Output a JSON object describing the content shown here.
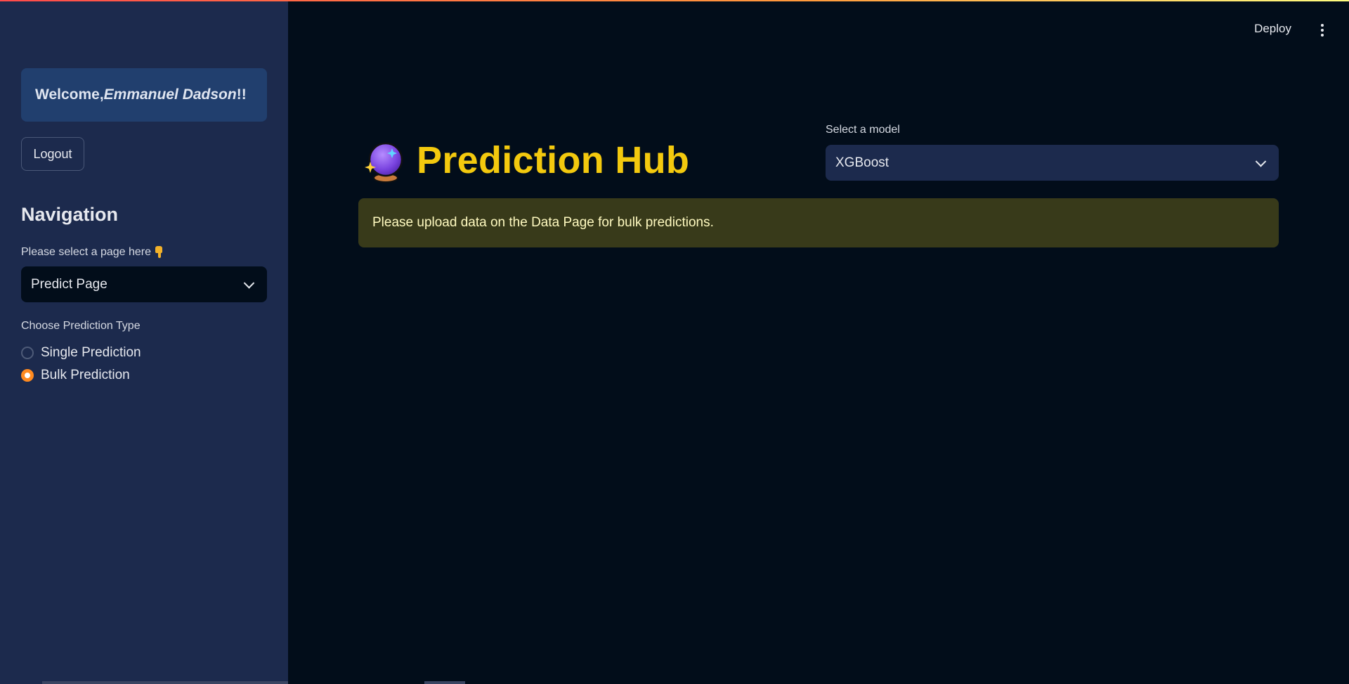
{
  "header": {
    "deploy_label": "Deploy",
    "menu_icon": "kebab-menu-icon"
  },
  "sidebar": {
    "welcome_prefix": "Welcome, ",
    "user_name": "Emmanuel Dadson",
    "welcome_suffix": "!!",
    "logout_label": "Logout",
    "nav_title": "Navigation",
    "page_select_label": "Please select a page here",
    "page_select_icon": "pointing-down-hand-icon",
    "page_select_value": "Predict Page",
    "prediction_type_label": "Choose Prediction Type",
    "prediction_types": [
      {
        "label": "Single Prediction",
        "selected": false
      },
      {
        "label": "Bulk Prediction",
        "selected": true
      }
    ]
  },
  "main": {
    "title_icon": "crystal-ball-icon",
    "title": "Prediction Hub",
    "model_select_label": "Select a model",
    "model_select_value": "XGBoost",
    "warning_message": "Please upload data on the Data Page for bulk predictions."
  },
  "colors": {
    "sidebar_bg": "#1c2a4d",
    "main_bg": "#020d1a",
    "title_color": "#f3c90e",
    "radio_accent": "#ff8a1f",
    "warning_bg": "#383a1a",
    "warning_text": "#fffac0"
  }
}
